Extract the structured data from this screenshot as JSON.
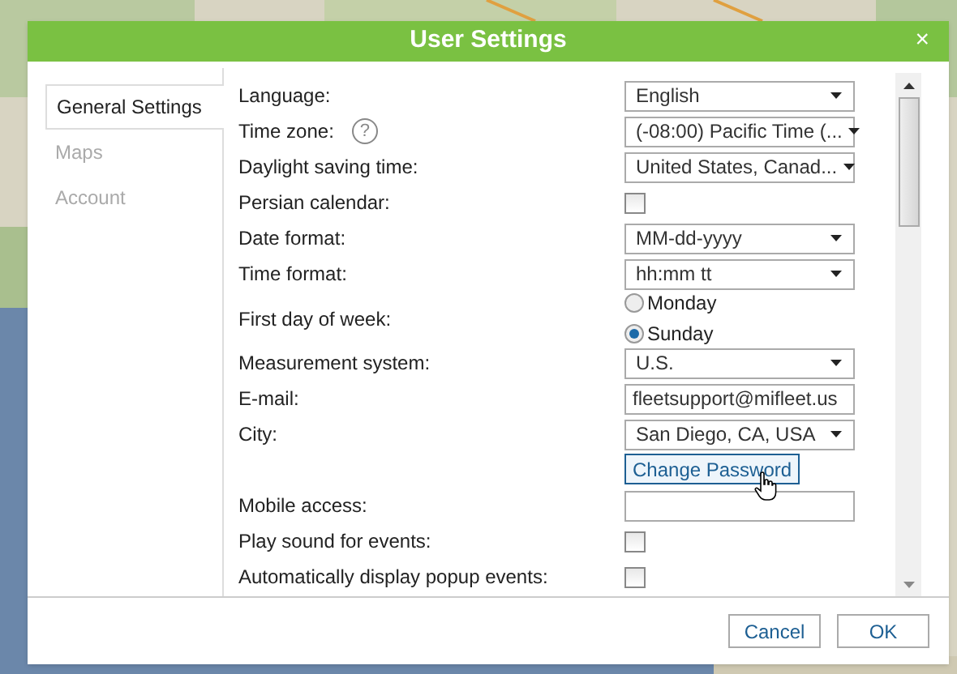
{
  "dialog": {
    "title": "User Settings",
    "close": "×"
  },
  "tabs": [
    {
      "label": "General Settings",
      "selected": true
    },
    {
      "label": "Maps",
      "selected": false
    },
    {
      "label": "Account",
      "selected": false
    }
  ],
  "fields": [
    {
      "kind": "select",
      "label": "Language:",
      "value": "English"
    },
    {
      "kind": "select",
      "label": "Time zone:",
      "value": "(-08:00) Pacific Time (...",
      "help": "?"
    },
    {
      "kind": "select",
      "label": "Daylight saving time:",
      "value": "United States, Canad..."
    },
    {
      "kind": "checkbox",
      "label": "Persian calendar:",
      "checked": false
    },
    {
      "kind": "select",
      "label": "Date format:",
      "value": "MM-dd-yyyy"
    },
    {
      "kind": "select",
      "label": "Time format:",
      "value": "hh:mm tt"
    },
    {
      "kind": "radio",
      "label": "First day of week:",
      "options": [
        {
          "label": "Monday",
          "selected": false
        },
        {
          "label": "Sunday",
          "selected": true
        }
      ]
    },
    {
      "kind": "select",
      "label": "Measurement system:",
      "value": "U.S."
    },
    {
      "kind": "text",
      "label": "E-mail:",
      "value": "fleetsupport@mifleet.us"
    },
    {
      "kind": "select",
      "label": "City:",
      "value": "San Diego, CA, USA"
    },
    {
      "kind": "button",
      "label": "Change Password"
    },
    {
      "kind": "text",
      "label": "Mobile access:"
    },
    {
      "kind": "checkbox",
      "label": "Play sound for events:",
      "checked": false
    },
    {
      "kind": "checkbox",
      "label": "Automatically display popup events:",
      "checked": false
    }
  ],
  "buttons": [
    {
      "label": "Cancel"
    },
    {
      "label": "OK"
    }
  ]
}
